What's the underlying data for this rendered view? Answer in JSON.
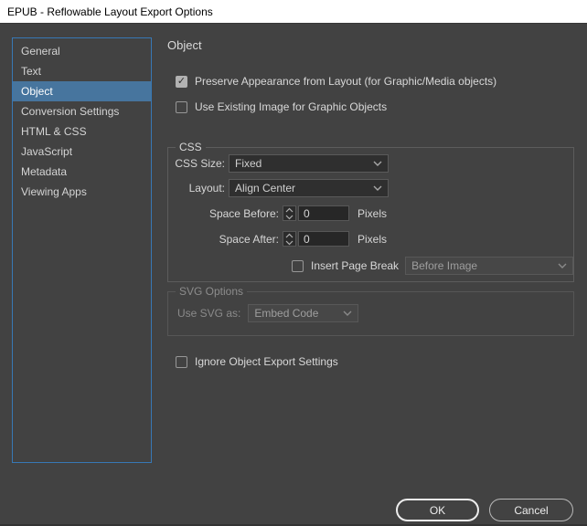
{
  "window": {
    "title": "EPUB - Reflowable Layout Export Options"
  },
  "sidebar": {
    "items": [
      {
        "label": "General",
        "selected": false
      },
      {
        "label": "Text",
        "selected": false
      },
      {
        "label": "Object",
        "selected": true
      },
      {
        "label": "Conversion Settings",
        "selected": false
      },
      {
        "label": "HTML & CSS",
        "selected": false
      },
      {
        "label": "JavaScript",
        "selected": false
      },
      {
        "label": "Metadata",
        "selected": false
      },
      {
        "label": "Viewing Apps",
        "selected": false
      }
    ]
  },
  "panel": {
    "heading": "Object",
    "preserve_appearance": {
      "label": "Preserve Appearance from Layout (for Graphic/Media objects)",
      "checked": true
    },
    "use_existing_image": {
      "label": "Use Existing Image for Graphic Objects",
      "checked": false
    },
    "css_group": {
      "legend": "CSS",
      "css_size": {
        "label": "CSS Size:",
        "value": "Fixed"
      },
      "layout": {
        "label": "Layout:",
        "value": "Align Center"
      },
      "space_before": {
        "label": "Space Before:",
        "value": "0",
        "unit": "Pixels"
      },
      "space_after": {
        "label": "Space After:",
        "value": "0",
        "unit": "Pixels"
      },
      "page_break": {
        "label": "Insert Page Break",
        "checked": false,
        "value": "Before Image",
        "enabled": false
      }
    },
    "svg_group": {
      "legend": "SVG Options",
      "use_svg_as": {
        "label": "Use SVG as:",
        "value": "Embed Code",
        "enabled": false
      }
    },
    "ignore_settings": {
      "label": "Ignore Object Export Settings",
      "checked": false
    }
  },
  "buttons": {
    "ok": "OK",
    "cancel": "Cancel"
  },
  "icons": {
    "check": "✓"
  },
  "colors": {
    "dialog_bg": "#424242",
    "titlebar_bg": "#ffffff",
    "sidebar_border": "#3778b5",
    "selection_blue": "#47759e",
    "label_text": "#d6d6d6",
    "disabled_text": "#8a8a8a"
  }
}
